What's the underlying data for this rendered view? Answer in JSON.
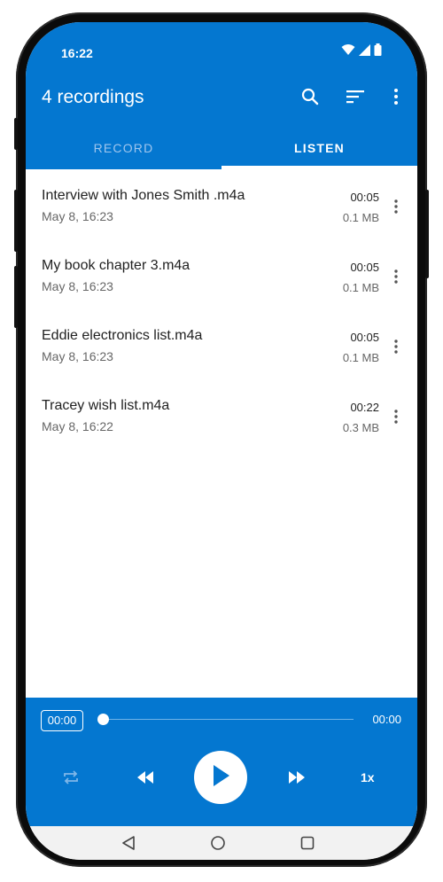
{
  "status": {
    "time": "16:22",
    "icons": [
      "wifi-icon",
      "signal-icon",
      "battery-icon"
    ]
  },
  "app_bar": {
    "title": "4 recordings",
    "icons": [
      "search-icon",
      "sort-icon",
      "more-vert-icon"
    ]
  },
  "tabs": [
    {
      "label": "RECORD",
      "selected": false
    },
    {
      "label": "LISTEN",
      "selected": true
    }
  ],
  "recordings": [
    {
      "name": "Interview with Jones Smith .m4a",
      "date": "May 8, 16:23",
      "duration": "00:05",
      "size": "0.1 MB"
    },
    {
      "name": "My book chapter 3.m4a",
      "date": "May 8, 16:23",
      "duration": "00:05",
      "size": "0.1 MB"
    },
    {
      "name": "Eddie electronics list.m4a",
      "date": "May 8, 16:23",
      "duration": "00:05",
      "size": "0.1 MB"
    },
    {
      "name": "Tracey wish list.m4a",
      "date": "May 8, 16:22",
      "duration": "00:22",
      "size": "0.3 MB"
    }
  ],
  "player": {
    "current_time": "00:00",
    "total_time": "00:00",
    "progress": 0,
    "speed": "1x",
    "controls": [
      "repeat-icon",
      "rewind-icon",
      "play-icon",
      "fast-forward-icon"
    ]
  },
  "nav": {
    "icons": [
      "back-icon",
      "home-icon",
      "recents-icon"
    ]
  },
  "colors": {
    "primary": "#0477d0",
    "on_primary": "#ffffff",
    "text": "#222222",
    "secondary_text": "#666666"
  }
}
